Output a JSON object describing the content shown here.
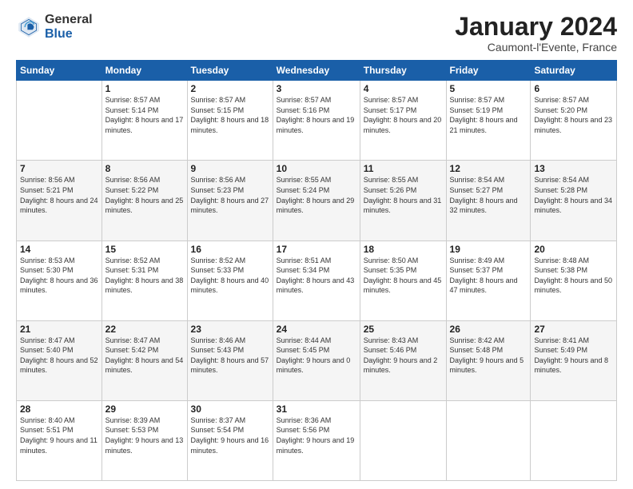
{
  "header": {
    "logo": {
      "general": "General",
      "blue": "Blue"
    },
    "title": "January 2024",
    "location": "Caumont-l'Evente, France"
  },
  "columns": [
    "Sunday",
    "Monday",
    "Tuesday",
    "Wednesday",
    "Thursday",
    "Friday",
    "Saturday"
  ],
  "weeks": [
    [
      {
        "day": "",
        "sunrise": "",
        "sunset": "",
        "daylight": ""
      },
      {
        "day": "1",
        "sunrise": "Sunrise: 8:57 AM",
        "sunset": "Sunset: 5:14 PM",
        "daylight": "Daylight: 8 hours and 17 minutes."
      },
      {
        "day": "2",
        "sunrise": "Sunrise: 8:57 AM",
        "sunset": "Sunset: 5:15 PM",
        "daylight": "Daylight: 8 hours and 18 minutes."
      },
      {
        "day": "3",
        "sunrise": "Sunrise: 8:57 AM",
        "sunset": "Sunset: 5:16 PM",
        "daylight": "Daylight: 8 hours and 19 minutes."
      },
      {
        "day": "4",
        "sunrise": "Sunrise: 8:57 AM",
        "sunset": "Sunset: 5:17 PM",
        "daylight": "Daylight: 8 hours and 20 minutes."
      },
      {
        "day": "5",
        "sunrise": "Sunrise: 8:57 AM",
        "sunset": "Sunset: 5:19 PM",
        "daylight": "Daylight: 8 hours and 21 minutes."
      },
      {
        "day": "6",
        "sunrise": "Sunrise: 8:57 AM",
        "sunset": "Sunset: 5:20 PM",
        "daylight": "Daylight: 8 hours and 23 minutes."
      }
    ],
    [
      {
        "day": "7",
        "sunrise": "Sunrise: 8:56 AM",
        "sunset": "Sunset: 5:21 PM",
        "daylight": "Daylight: 8 hours and 24 minutes."
      },
      {
        "day": "8",
        "sunrise": "Sunrise: 8:56 AM",
        "sunset": "Sunset: 5:22 PM",
        "daylight": "Daylight: 8 hours and 25 minutes."
      },
      {
        "day": "9",
        "sunrise": "Sunrise: 8:56 AM",
        "sunset": "Sunset: 5:23 PM",
        "daylight": "Daylight: 8 hours and 27 minutes."
      },
      {
        "day": "10",
        "sunrise": "Sunrise: 8:55 AM",
        "sunset": "Sunset: 5:24 PM",
        "daylight": "Daylight: 8 hours and 29 minutes."
      },
      {
        "day": "11",
        "sunrise": "Sunrise: 8:55 AM",
        "sunset": "Sunset: 5:26 PM",
        "daylight": "Daylight: 8 hours and 31 minutes."
      },
      {
        "day": "12",
        "sunrise": "Sunrise: 8:54 AM",
        "sunset": "Sunset: 5:27 PM",
        "daylight": "Daylight: 8 hours and 32 minutes."
      },
      {
        "day": "13",
        "sunrise": "Sunrise: 8:54 AM",
        "sunset": "Sunset: 5:28 PM",
        "daylight": "Daylight: 8 hours and 34 minutes."
      }
    ],
    [
      {
        "day": "14",
        "sunrise": "Sunrise: 8:53 AM",
        "sunset": "Sunset: 5:30 PM",
        "daylight": "Daylight: 8 hours and 36 minutes."
      },
      {
        "day": "15",
        "sunrise": "Sunrise: 8:52 AM",
        "sunset": "Sunset: 5:31 PM",
        "daylight": "Daylight: 8 hours and 38 minutes."
      },
      {
        "day": "16",
        "sunrise": "Sunrise: 8:52 AM",
        "sunset": "Sunset: 5:33 PM",
        "daylight": "Daylight: 8 hours and 40 minutes."
      },
      {
        "day": "17",
        "sunrise": "Sunrise: 8:51 AM",
        "sunset": "Sunset: 5:34 PM",
        "daylight": "Daylight: 8 hours and 43 minutes."
      },
      {
        "day": "18",
        "sunrise": "Sunrise: 8:50 AM",
        "sunset": "Sunset: 5:35 PM",
        "daylight": "Daylight: 8 hours and 45 minutes."
      },
      {
        "day": "19",
        "sunrise": "Sunrise: 8:49 AM",
        "sunset": "Sunset: 5:37 PM",
        "daylight": "Daylight: 8 hours and 47 minutes."
      },
      {
        "day": "20",
        "sunrise": "Sunrise: 8:48 AM",
        "sunset": "Sunset: 5:38 PM",
        "daylight": "Daylight: 8 hours and 50 minutes."
      }
    ],
    [
      {
        "day": "21",
        "sunrise": "Sunrise: 8:47 AM",
        "sunset": "Sunset: 5:40 PM",
        "daylight": "Daylight: 8 hours and 52 minutes."
      },
      {
        "day": "22",
        "sunrise": "Sunrise: 8:47 AM",
        "sunset": "Sunset: 5:42 PM",
        "daylight": "Daylight: 8 hours and 54 minutes."
      },
      {
        "day": "23",
        "sunrise": "Sunrise: 8:46 AM",
        "sunset": "Sunset: 5:43 PM",
        "daylight": "Daylight: 8 hours and 57 minutes."
      },
      {
        "day": "24",
        "sunrise": "Sunrise: 8:44 AM",
        "sunset": "Sunset: 5:45 PM",
        "daylight": "Daylight: 9 hours and 0 minutes."
      },
      {
        "day": "25",
        "sunrise": "Sunrise: 8:43 AM",
        "sunset": "Sunset: 5:46 PM",
        "daylight": "Daylight: 9 hours and 2 minutes."
      },
      {
        "day": "26",
        "sunrise": "Sunrise: 8:42 AM",
        "sunset": "Sunset: 5:48 PM",
        "daylight": "Daylight: 9 hours and 5 minutes."
      },
      {
        "day": "27",
        "sunrise": "Sunrise: 8:41 AM",
        "sunset": "Sunset: 5:49 PM",
        "daylight": "Daylight: 9 hours and 8 minutes."
      }
    ],
    [
      {
        "day": "28",
        "sunrise": "Sunrise: 8:40 AM",
        "sunset": "Sunset: 5:51 PM",
        "daylight": "Daylight: 9 hours and 11 minutes."
      },
      {
        "day": "29",
        "sunrise": "Sunrise: 8:39 AM",
        "sunset": "Sunset: 5:53 PM",
        "daylight": "Daylight: 9 hours and 13 minutes."
      },
      {
        "day": "30",
        "sunrise": "Sunrise: 8:37 AM",
        "sunset": "Sunset: 5:54 PM",
        "daylight": "Daylight: 9 hours and 16 minutes."
      },
      {
        "day": "31",
        "sunrise": "Sunrise: 8:36 AM",
        "sunset": "Sunset: 5:56 PM",
        "daylight": "Daylight: 9 hours and 19 minutes."
      },
      {
        "day": "",
        "sunrise": "",
        "sunset": "",
        "daylight": ""
      },
      {
        "day": "",
        "sunrise": "",
        "sunset": "",
        "daylight": ""
      },
      {
        "day": "",
        "sunrise": "",
        "sunset": "",
        "daylight": ""
      }
    ]
  ]
}
